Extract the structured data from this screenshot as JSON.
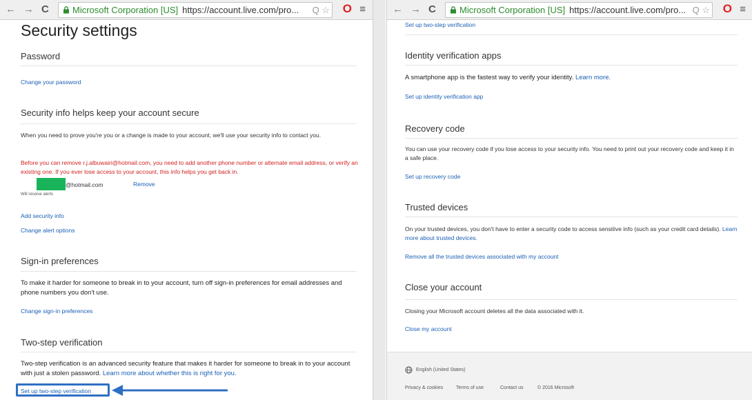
{
  "browser": {
    "back_glyph": "←",
    "forward_glyph": "→",
    "reload_glyph": "C",
    "ev_label": "Microsoft Corporation [US]",
    "url": "https://account.live.com/pro...",
    "search_glyph": "Q",
    "star_glyph": "☆",
    "opera_glyph": "O",
    "menu_glyph": "≡",
    "colors": {
      "ev": "#2e8b2e",
      "opera": "#e02020"
    }
  },
  "left": {
    "page_title": "Security settings",
    "password": {
      "heading": "Password",
      "link": "Change your password"
    },
    "security_info": {
      "heading": "Security info helps keep your account secure",
      "intro": "When you need to prove you're you or a change is made to your account, we'll use your security info to contact you.",
      "warning": "Before you can remove r.j.albuwairi@hotmail.com, you need to add another phone number or alternate email address, or verify an existing one. If you ever lose access to your account, this info helps you get back in.",
      "email_suffix": "@hotmail.com",
      "remove_link": "Remove",
      "receive_note": "Will receive alerts",
      "add_link": "Add security info",
      "alert_link": "Change alert options"
    },
    "sign_in": {
      "heading": "Sign-in preferences",
      "text": "To make it harder for someone to break in to your account, turn off sign-in preferences for email addresses and phone numbers you don't use.",
      "link": "Change sign-in preferences"
    },
    "two_step": {
      "heading": "Two-step verification",
      "text": "Two-step verification is an advanced security feature that makes it harder for someone to break in to your account with just a stolen password.",
      "learn_link": "Learn more about whether this is right for you.",
      "setup_link": "Set up two-step verification"
    }
  },
  "right": {
    "top_link": "Set up two-step verification",
    "identity": {
      "heading": "Identity verification apps",
      "text": "A smartphone app is the fastest way to verify your identity.",
      "learn_link": "Learn more.",
      "link": "Set up identity verification app"
    },
    "recovery": {
      "heading": "Recovery code",
      "text": "You can use your recovery code if you lose access to your security info. You need to print out your recovery code and keep it in a safe place.",
      "link": "Set up recovery code"
    },
    "trusted": {
      "heading": "Trusted devices",
      "text": "On your trusted devices, you don't have to enter a security code to access sensitive info (such as your credit card details).",
      "learn_link": "Learn more about trusted devices.",
      "link": "Remove all the trusted devices associated with my account"
    },
    "close": {
      "heading": "Close your account",
      "text": "Closing your Microsoft account deletes all the data associated with it.",
      "link": "Close my account"
    },
    "footer": {
      "language": "English (United States)",
      "privacy": "Privacy & cookies",
      "terms": "Terms of use",
      "contact": "Contact us",
      "copyright": "© 2016 Microsoft"
    }
  },
  "annotation": {
    "color": "#2e6fc4"
  }
}
